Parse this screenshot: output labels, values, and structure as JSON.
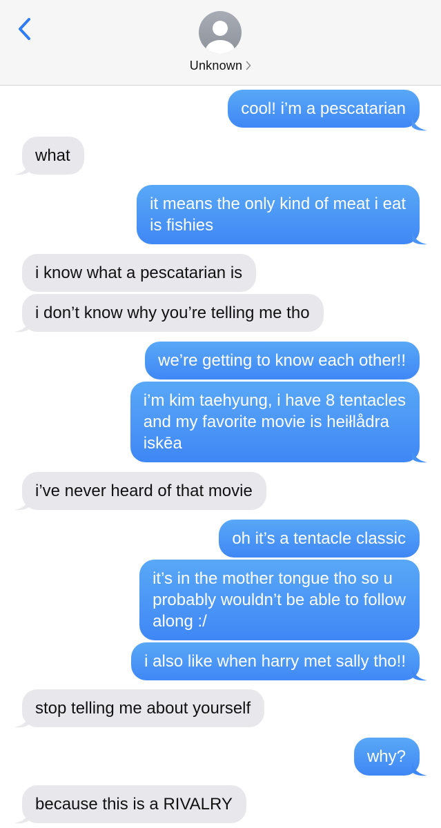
{
  "header": {
    "contact_name": "Unknown",
    "back_icon": "chevron-left-icon",
    "avatar_icon": "person-silhouette-icon",
    "disclosure_icon": "chevron-right-icon"
  },
  "colors": {
    "incoming_bubble": "#e8e8ec",
    "outgoing_bubble_top": "#59a8f7",
    "outgoing_bubble_bottom": "#3f87f5",
    "accent": "#2f7cf6",
    "header_bg": "#f6f6f6"
  },
  "messages": [
    {
      "from": "me",
      "text": "cool! i’m a pescatarian"
    },
    {
      "from": "them",
      "text": "what"
    },
    {
      "from": "me",
      "lines": [
        "it means the only kind of meat i eat",
        "is fishies"
      ]
    },
    {
      "from": "them",
      "text": "i know what a pescatarian is"
    },
    {
      "from": "them",
      "text": "i don’t know why you’re telling me tho"
    },
    {
      "from": "me",
      "text": "we’re getting to know each other!!"
    },
    {
      "from": "me",
      "lines": [
        "i’m kim taehyung, i have 8 tentacles",
        "and my favorite movie is heiłlådra",
        "iskēa"
      ]
    },
    {
      "from": "them",
      "text": "i’ve never heard of that movie"
    },
    {
      "from": "me",
      "text": "oh it’s a tentacle classic"
    },
    {
      "from": "me",
      "lines": [
        "it’s in the mother tongue tho so u",
        "probably wouldn’t be able to follow",
        "along :/"
      ]
    },
    {
      "from": "me",
      "text": "i also like when harry met sally tho!!"
    },
    {
      "from": "them",
      "text": "stop telling me about yourself"
    },
    {
      "from": "me",
      "text": "why?"
    },
    {
      "from": "them",
      "text": "because this is a RIVALRY"
    }
  ]
}
